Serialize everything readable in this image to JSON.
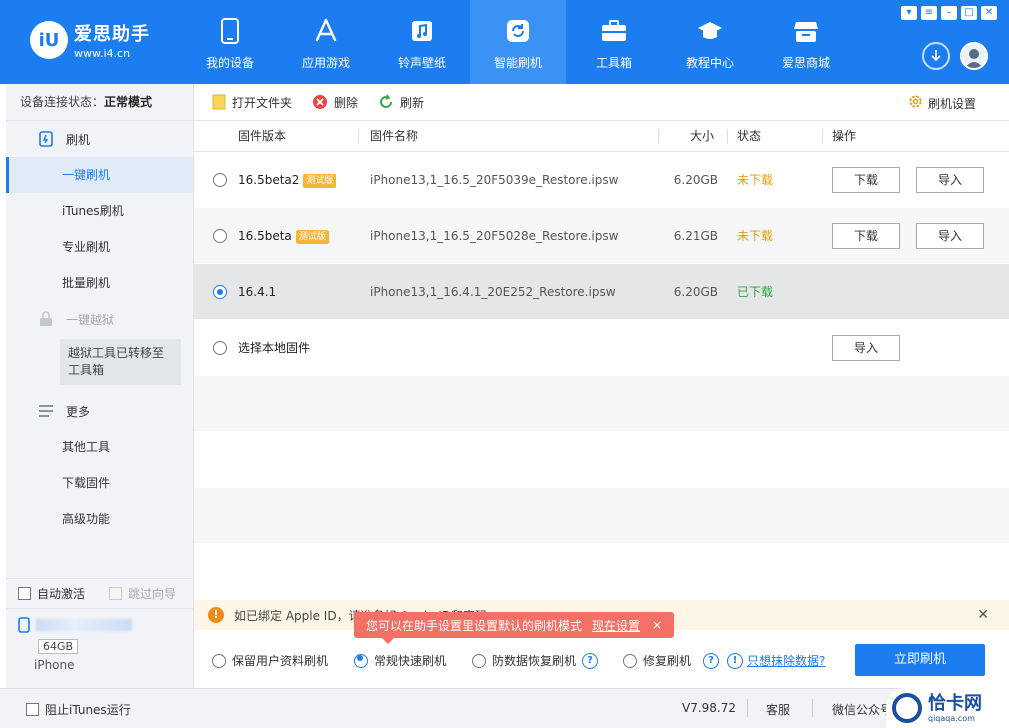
{
  "colors": {
    "brand": "#1b7df0",
    "warning": "#e6a000",
    "success": "#2aa83a",
    "toast": "#f27066",
    "beta_tag": "#f7b538"
  },
  "header": {
    "logo_mark": "iU",
    "logo_name": "爱思助手",
    "logo_url": "www.i4.cn",
    "nav": [
      {
        "label": "我的设备",
        "icon": "phone-icon"
      },
      {
        "label": "应用游戏",
        "icon": "app-store-icon"
      },
      {
        "label": "铃声壁纸",
        "icon": "music-icon"
      },
      {
        "label": "智能刷机",
        "icon": "refresh-icon",
        "active": true
      },
      {
        "label": "工具箱",
        "icon": "toolbox-icon"
      },
      {
        "label": "教程中心",
        "icon": "graduation-cap-icon"
      },
      {
        "label": "爱思商城",
        "icon": "store-icon"
      }
    ],
    "window_controls": [
      "shirt-icon",
      "minimize-icon",
      "restore-icon",
      "close-icon"
    ]
  },
  "sidebar": {
    "status_label": "设备连接状态：",
    "status_value": "正常模式",
    "flash_group": "刷机",
    "items": [
      "一键刷机",
      "iTunes刷机",
      "专业刷机",
      "批量刷机"
    ],
    "jailbreak_group": "一键越狱",
    "jailbreak_note": "越狱工具已转移至工具箱",
    "more_group": "更多",
    "more_items": [
      "其他工具",
      "下载固件",
      "高级功能"
    ],
    "auto_activate": "自动激活",
    "skip_guide": "跳过向导",
    "device_storage": "64GB",
    "device_model": "iPhone"
  },
  "toolbar": {
    "open_folder": "打开文件夹",
    "delete": "删除",
    "refresh": "刷新",
    "settings": "刷机设置"
  },
  "table": {
    "headers": {
      "version": "固件版本",
      "name": "固件名称",
      "size": "大小",
      "status": "状态",
      "action": "操作"
    },
    "rows": [
      {
        "version": "16.5beta2",
        "tag": "测试版",
        "name": "iPhone13,1_16.5_20F5039e_Restore.ipsw",
        "size": "6.20GB",
        "status": "未下载",
        "download": "下载",
        "import": "导入"
      },
      {
        "version": "16.5beta",
        "tag": "测试版",
        "name": "iPhone13,1_16.5_20F5028e_Restore.ipsw",
        "size": "6.21GB",
        "status": "未下载",
        "download": "下载",
        "import": "导入"
      },
      {
        "version": "16.4.1",
        "name": "iPhone13,1_16.4.1_20E252_Restore.ipsw",
        "size": "6.20GB",
        "status": "已下载"
      },
      {
        "version": "选择本地固件",
        "import": "导入"
      }
    ]
  },
  "notice": {
    "text": "如已绑定 Apple ID，请准备好 Apple ID和密码",
    "toast_text": "您可以在助手设置里设置默认的刷机模式",
    "toast_link": "现在设置",
    "toast_close": "×",
    "close": "✕"
  },
  "options": {
    "keep_data": "保留用户资料刷机",
    "quick_flash": "常规快速刷机",
    "anti_recovery": "防数据恢复刷机",
    "repair": "修复刷机",
    "wipe_link": "只想抹除数据?",
    "flash_now": "立即刷机"
  },
  "statusbar": {
    "block_itunes": "阻止iTunes运行",
    "version": "V7.98.72",
    "service": "客服",
    "wechat": "微信公众号"
  },
  "watermark": {
    "name": "恰卡网",
    "url": "qiqaqa.com"
  }
}
